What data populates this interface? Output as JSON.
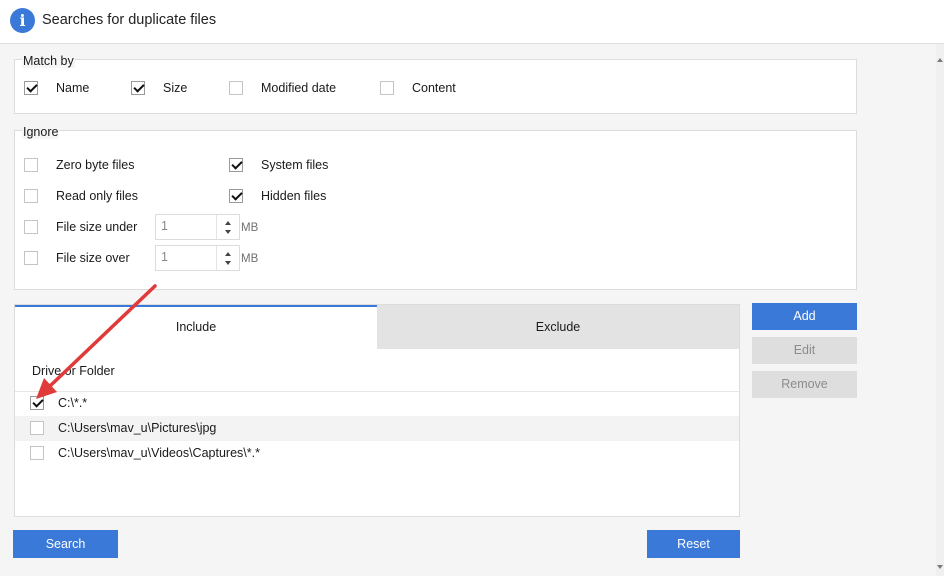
{
  "header": {
    "title": "Searches for duplicate files",
    "icon": "info-icon"
  },
  "match_by": {
    "legend": "Match by",
    "options": [
      {
        "label": "Name",
        "checked": true
      },
      {
        "label": "Size",
        "checked": true
      },
      {
        "label": "Modified date",
        "checked": false
      },
      {
        "label": "Content",
        "checked": false
      }
    ]
  },
  "ignore": {
    "legend": "Ignore",
    "zero_byte": {
      "label": "Zero byte files",
      "checked": false
    },
    "read_only": {
      "label": "Read only files",
      "checked": false
    },
    "size_under": {
      "label": "File size under",
      "checked": false,
      "value": "1",
      "unit": "MB"
    },
    "size_over": {
      "label": "File size over",
      "checked": false,
      "value": "1",
      "unit": "MB"
    },
    "system_files": {
      "label": "System files",
      "checked": true
    },
    "hidden_files": {
      "label": "Hidden files",
      "checked": true
    }
  },
  "tabs": {
    "include": "Include",
    "exclude": "Exclude",
    "active": "include"
  },
  "folders": {
    "column_header": "Drive or Folder",
    "rows": [
      {
        "path": "C:\\*.*",
        "checked": true
      },
      {
        "path": "C:\\Users\\mav_u\\Pictures\\jpg",
        "checked": false
      },
      {
        "path": "C:\\Users\\mav_u\\Videos\\Captures\\*.*",
        "checked": false
      }
    ]
  },
  "side_buttons": {
    "add": "Add",
    "edit": "Edit",
    "remove": "Remove"
  },
  "footer": {
    "search": "Search",
    "reset": "Reset"
  },
  "colors": {
    "accent": "#3b79d8",
    "annotation_arrow": "#e03a3a"
  }
}
